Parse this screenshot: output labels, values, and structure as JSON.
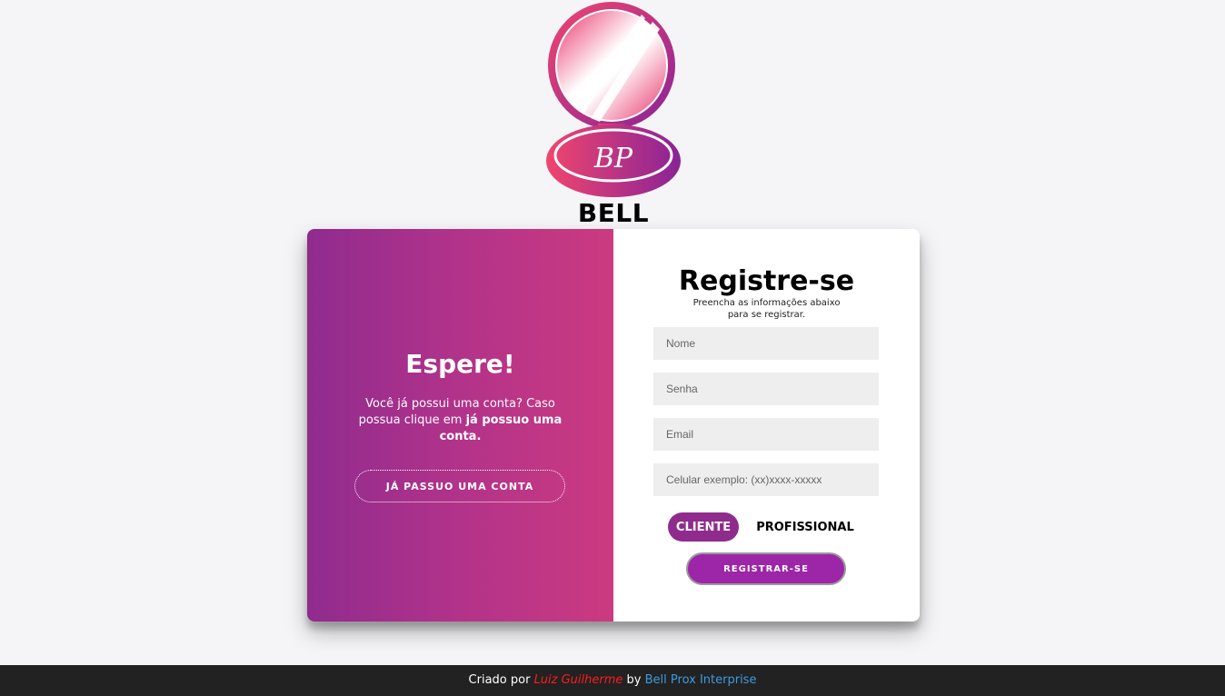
{
  "brand": {
    "name": "BELL PROX",
    "logo_monogram": "BP",
    "logo_icon": "compact-mirror-icon"
  },
  "left_panel": {
    "title": "Espere!",
    "text_before": "Você já possui uma conta? Caso possua clique em ",
    "text_bold": "já possuo uma conta.",
    "button_label": "JÁ PASSUO UMA CONTA"
  },
  "register": {
    "title": "Registre-se",
    "subtitle": "Preencha as informações abaixo para se registrar.",
    "fields": {
      "nome_placeholder": "Nome",
      "senha_placeholder": "Senha",
      "email_placeholder": "Email",
      "celular_placeholder": "Celular exemplo: (xx)xxxx-xxxxx"
    },
    "type_options": [
      "CLIENTE",
      "PROFISSIONAL"
    ],
    "selected_type": "CLIENTE",
    "submit_label": "REGISTRAR-SE"
  },
  "footer": {
    "created_by": "Criado por",
    "author": "Luiz Guilherme",
    "by": "by",
    "company": "Bell Prox Interprise"
  },
  "colors": {
    "accent_purple": "#902b8e",
    "accent_pink": "#cc3a80",
    "register_button": "#9d25a8",
    "footer_bg": "#222222",
    "author_red": "#ff1b1b",
    "company_blue": "#3d9be0"
  }
}
